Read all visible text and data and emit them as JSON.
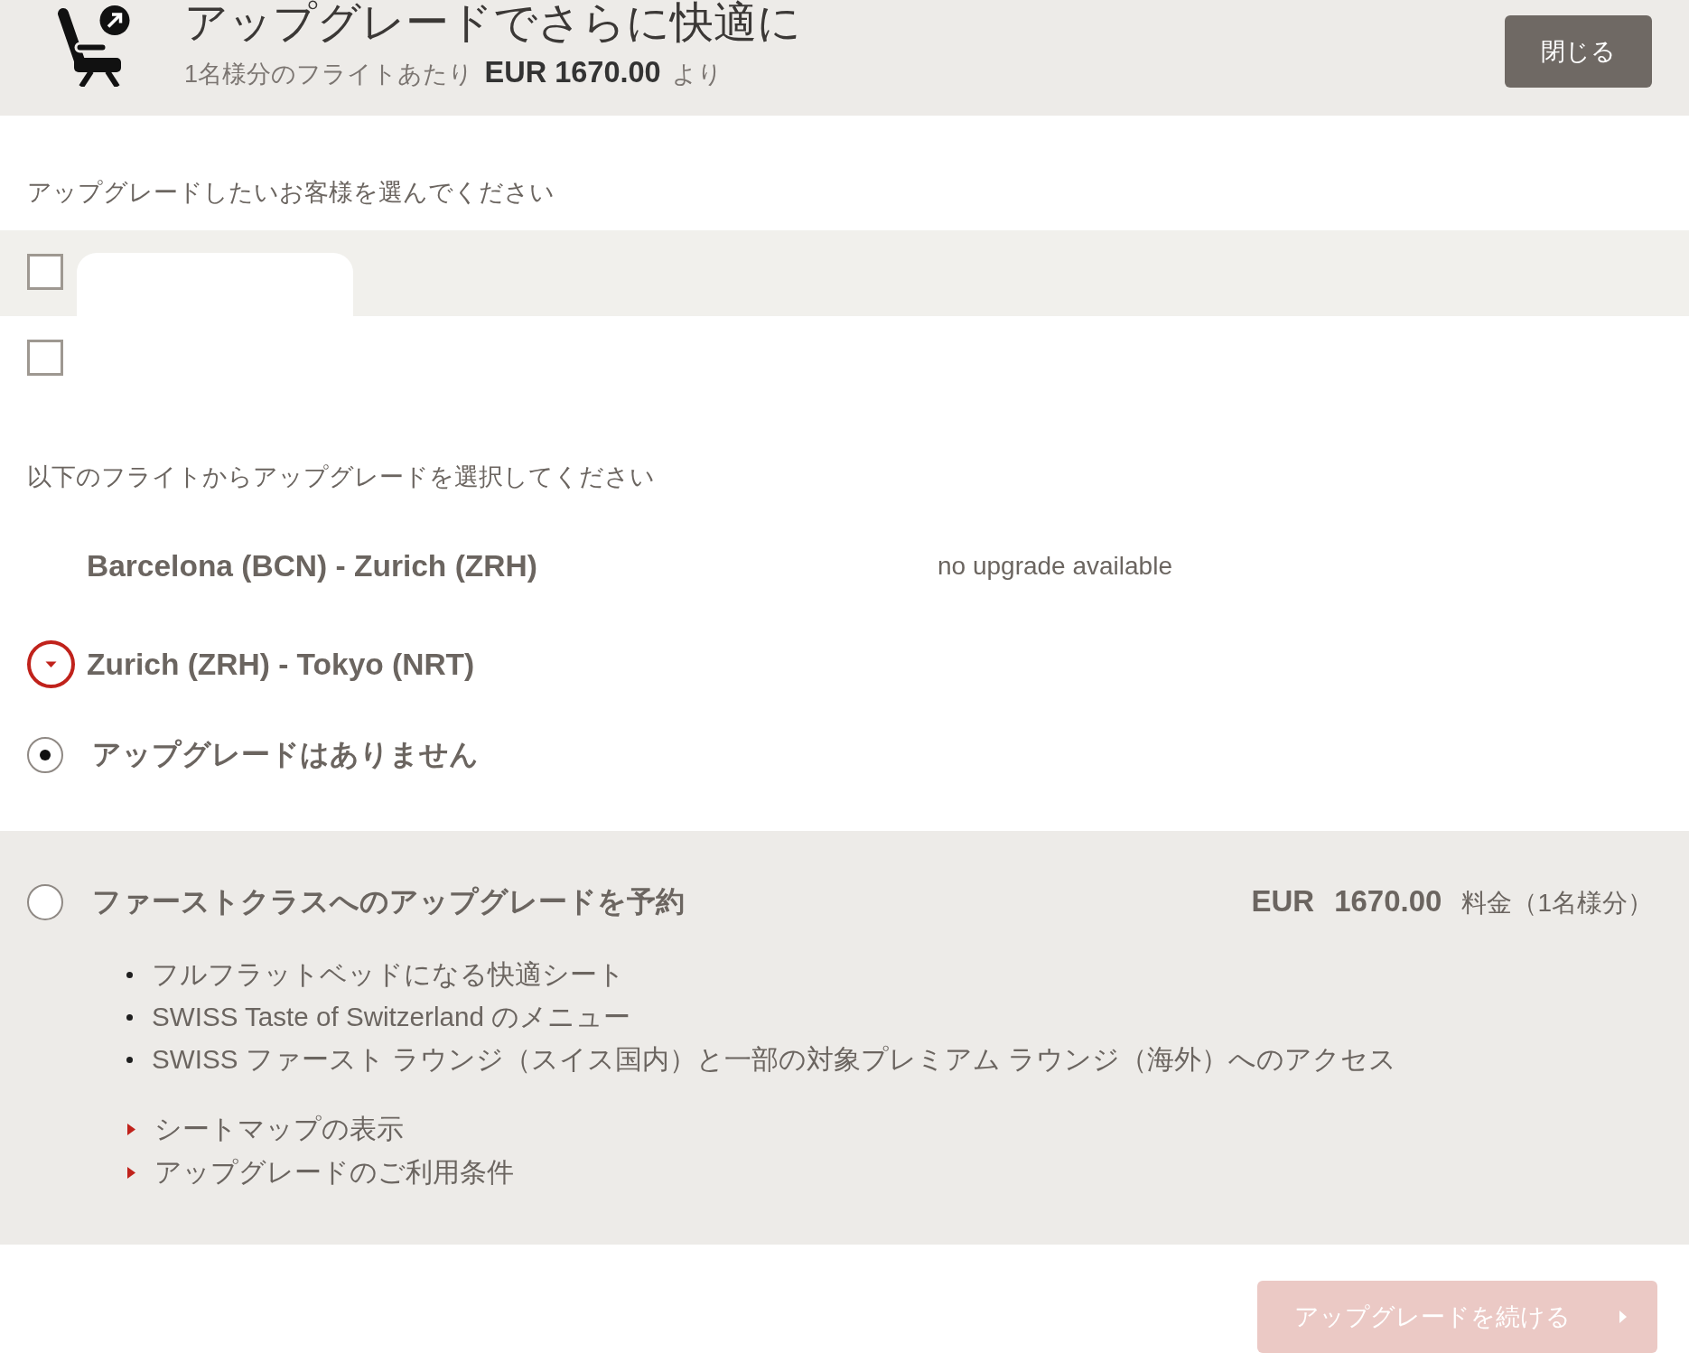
{
  "header": {
    "title": "アップグレードでさらに快適に",
    "subtitle": "1名様分のフライトあたり **EUR 1670.00** より",
    "close_button": "閉じる"
  },
  "passengers": {
    "heading": "アップグレードしたいお客様を選んでください",
    "items": [
      {
        "checked": false
      },
      {
        "checked": false
      }
    ]
  },
  "flights": {
    "heading": "以下のフライトからアップグレードを選択してください",
    "items": [
      {
        "kind": "unavailable",
        "route": "Barcelona (BCN) - Zurich (ZRH)",
        "note": "no upgrade available"
      },
      {
        "kind": "available",
        "route": "Zurich (ZRH) - Tokyo (NRT)",
        "expanded": true
      }
    ]
  },
  "options": [
    {
      "kind": "none",
      "label": "アップグレードはありません",
      "selected": true
    },
    {
      "kind": "upgrade",
      "label": "ファーストクラスへのアップグレードを予約",
      "selected": false,
      "currency": "EUR",
      "price": "1670.00",
      "price_note": "料金（1名様分）",
      "features": [
        "フルフラットベッドになる快適シート",
        "SWISS Taste of Switzerland のメニュー",
        "SWISS ファースト ラウンジ（スイス国内）と一部の対象プレミアム ラウンジ（海外）へのアクセス"
      ],
      "links": [
        "シートマップの表示",
        "アップグレードのご利用条件"
      ]
    }
  ],
  "continue_button": {
    "label": "アップグレードを続ける",
    "disabled": true
  }
}
